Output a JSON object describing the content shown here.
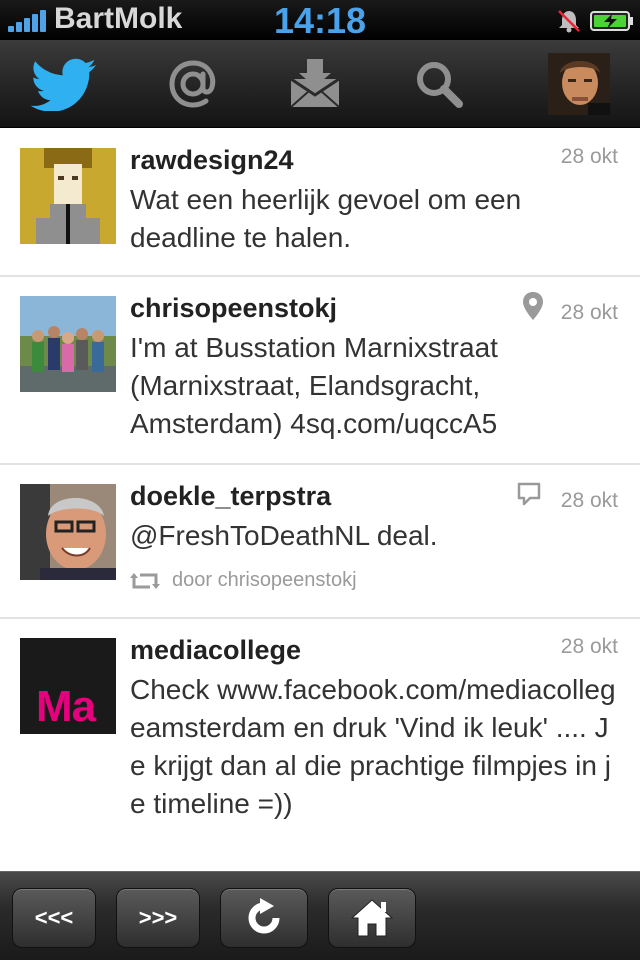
{
  "status_bar": {
    "carrier": "BartMolk",
    "time": "14:18",
    "signal_icon": "signal-bars-icon",
    "alarm_icon": "alarm-icon",
    "battery_icon": "battery-charging-icon"
  },
  "toolbar": {
    "items": [
      {
        "name": "home-timeline",
        "icon": "twitter-bird-icon"
      },
      {
        "name": "mentions",
        "icon": "at-sign-icon"
      },
      {
        "name": "direct-messages",
        "icon": "envelope-icon"
      },
      {
        "name": "search",
        "icon": "search-icon"
      },
      {
        "name": "profile",
        "icon": "avatar"
      }
    ]
  },
  "tweets": [
    {
      "user": "rawdesign24",
      "date": "28 okt",
      "text": "Wat een heerlijk gevoel om een deadline te halen."
    },
    {
      "user": "chrisopeenstokj",
      "date": "28 okt",
      "has_location": true,
      "text": "I'm at Busstation Marnixstraat (Marnixstraat, Elandsgracht, Amsterdam) 4sq.com/uqccA5"
    },
    {
      "user": "doekle_terpstra",
      "date": "28 okt",
      "has_reply": true,
      "text": "@FreshToDeathNL deal.",
      "retweeted_by": "door chrisopeenstokj"
    },
    {
      "user": "mediacollege",
      "date": "28 okt",
      "avatar_text": "Ma",
      "text": "Check www.facebook.com/mediacollegeamsterdam en druk 'Vind ik leuk' .... Je krijgt dan al die prachtige filmpjes in je timeline =))"
    }
  ],
  "bottom_bar": {
    "prev_label": "<<<",
    "next_label": ">>>",
    "refresh_icon": "refresh-icon",
    "home_icon": "home-icon"
  },
  "colors": {
    "accent_blue": "#4aa3ea",
    "toolbar_dark": "#262626",
    "meta_gray": "#9a9a9a",
    "media_pink": "#e6007e"
  }
}
